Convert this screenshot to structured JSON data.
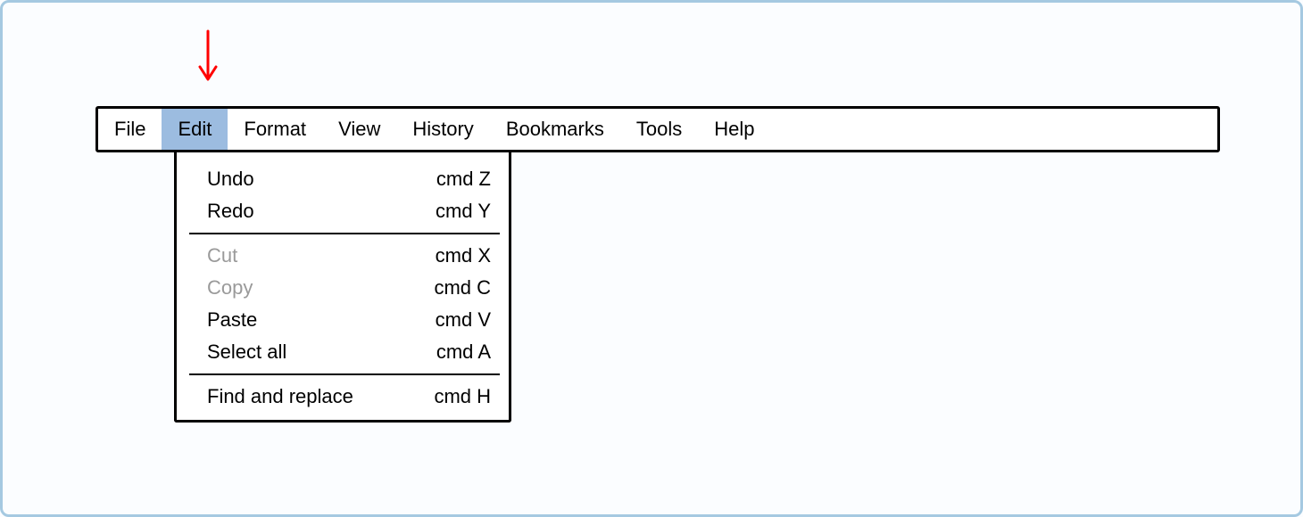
{
  "menubar": {
    "items": [
      {
        "label": "File"
      },
      {
        "label": "Edit"
      },
      {
        "label": "Format"
      },
      {
        "label": "View"
      },
      {
        "label": "History"
      },
      {
        "label": "Bookmarks"
      },
      {
        "label": "Tools"
      },
      {
        "label": "Help"
      }
    ],
    "active_index": 1
  },
  "edit_menu": {
    "items": [
      {
        "label": "Undo",
        "shortcut": "cmd Z",
        "disabled": false
      },
      {
        "label": "Redo",
        "shortcut": "cmd Y",
        "disabled": false
      },
      {
        "label": "Cut",
        "shortcut": "cmd X",
        "disabled": true
      },
      {
        "label": "Copy",
        "shortcut": "cmd C",
        "disabled": true
      },
      {
        "label": "Paste",
        "shortcut": "cmd V",
        "disabled": false
      },
      {
        "label": "Select all",
        "shortcut": "cmd A",
        "disabled": false
      },
      {
        "label": "Find and replace",
        "shortcut": "cmd H",
        "disabled": false
      }
    ]
  },
  "annotation": {
    "arrow_color": "#ff0000"
  }
}
